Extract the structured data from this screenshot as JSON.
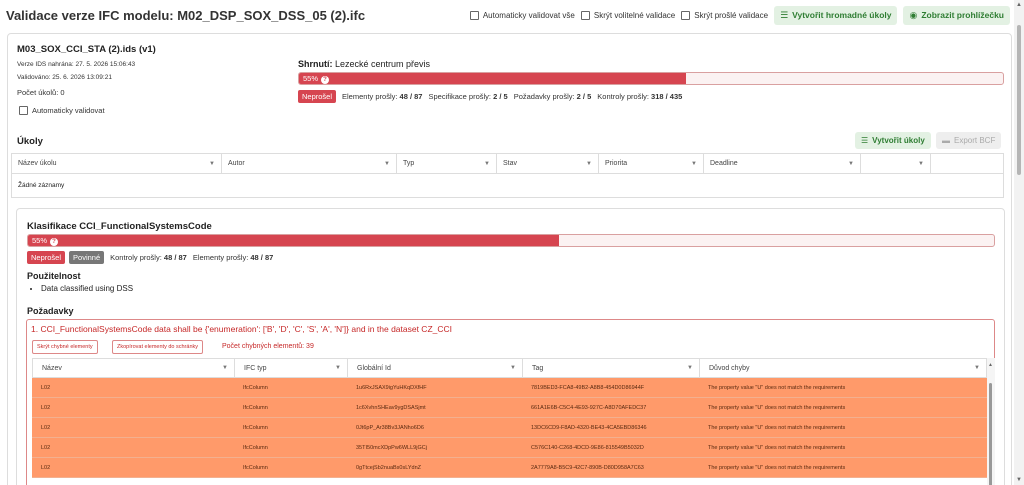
{
  "header": {
    "title": "Validace verze IFC modelu: M02_DSP_SOX_DSS_05 (2).ifc",
    "auto_validate_all": "Automaticky validovat vše",
    "hide_optional": "Skrýt volitelné validace",
    "hide_passed": "Skrýt prošlé validace",
    "create_bulk_tasks": "Vytvořit hromadné úkoly",
    "show_viewer": "Zobrazit prohlížečku"
  },
  "ids": {
    "name": "M03_SOX_CCI_STA (2).ids (v1)",
    "uploaded": "Verze IDS nahrána: 27. 5. 2026 15:06:43",
    "validated": "Validováno: 25. 6. 2026 13:09:21",
    "task_count": "Počet úkolů: 0",
    "auto_validate": "Automaticky validovat"
  },
  "summary": {
    "label": "Shrnutí:",
    "value": "Lezecké centrum převis",
    "progress_text": "55%",
    "progress": 0.55,
    "status": "Neprošel",
    "elements_label": "Elementy prošly:",
    "elements_value": "48 / 87",
    "specs_label": "Specifikace prošly:",
    "specs_value": "2 / 5",
    "reqs_label": "Požadavky prošly:",
    "reqs_value": "2 / 5",
    "checks_label": "Kontroly prošly:",
    "checks_value": "318 / 435"
  },
  "tasks": {
    "title": "Úkoly",
    "create_tasks": "Vytvořit úkoly",
    "export_bcf": "Export BCF",
    "columns": [
      "Název úkolu",
      "Autor",
      "Typ",
      "Stav",
      "Priorita",
      "Deadline",
      ""
    ],
    "empty": "Žádné záznamy"
  },
  "classification": {
    "title": "Klasifikace CCI_FunctionalSystemsCode",
    "progress_text": "55%",
    "progress": 0.55,
    "status": "Neprošel",
    "mandatory": "Povinné",
    "checks_label": "Kontroly prošly:",
    "checks_value": "48 / 87",
    "elements_label": "Elementy prošly:",
    "elements_value": "48 / 87",
    "applicability_title": "Použitelnost",
    "applicability_item": "Data classified using DSS",
    "requirements_title": "Požadavky",
    "requirement": "1. CCI_FunctionalSystemsCode data shall be {'enumeration': ['B', 'D', 'C', 'S', 'A', 'N']} and in the dataset CZ_CCI",
    "hide_errors": "Skrýt chybné elementy",
    "copy_errors": "Zkopírovat elementy do schránky",
    "error_count": "Počet chybných elementů: 39",
    "columns": [
      "Název",
      "IFC typ",
      "Globální Id",
      "Tag",
      "Důvod chyby"
    ],
    "rows": [
      [
        "L02",
        "IfcColumn",
        "1u6RxJSAX9igYuHKqDXfHF",
        "7819BED3-FCA8-49B2-A8B8-454D0D86944F",
        "The property value \"U\" does not match the requirements"
      ],
      [
        "L02",
        "IfcColumn",
        "1c6XvhnSHEav9ygDSASjmt",
        "661A1E6B-C5C4-4E93-927C-A8D70AFEDC37",
        "The property value \"U\" does not match the requirements"
      ],
      [
        "L02",
        "IfcColumn",
        "0Jt6pP_Ar38Bv3JANho6D6",
        "13DC6CD9-F8AD-4320-BE43-4CA5EBD86346",
        "The property value \"U\" does not match the requirements"
      ],
      [
        "L02",
        "IfcColumn",
        "35TI50mcXDpPw6WLL9jGCj",
        "C576C140-C268-4DCD-9E86-815549B5032D",
        "The property value \"U\" does not match the requirements"
      ],
      [
        "L02",
        "IfcColumn",
        "0gTtcejSb2nuaBs0sLYdnZ",
        "2A7779A8-B5C9-42C7-890B-D80D958A7C63",
        "The property value \"U\" does not match the requirements"
      ]
    ]
  }
}
